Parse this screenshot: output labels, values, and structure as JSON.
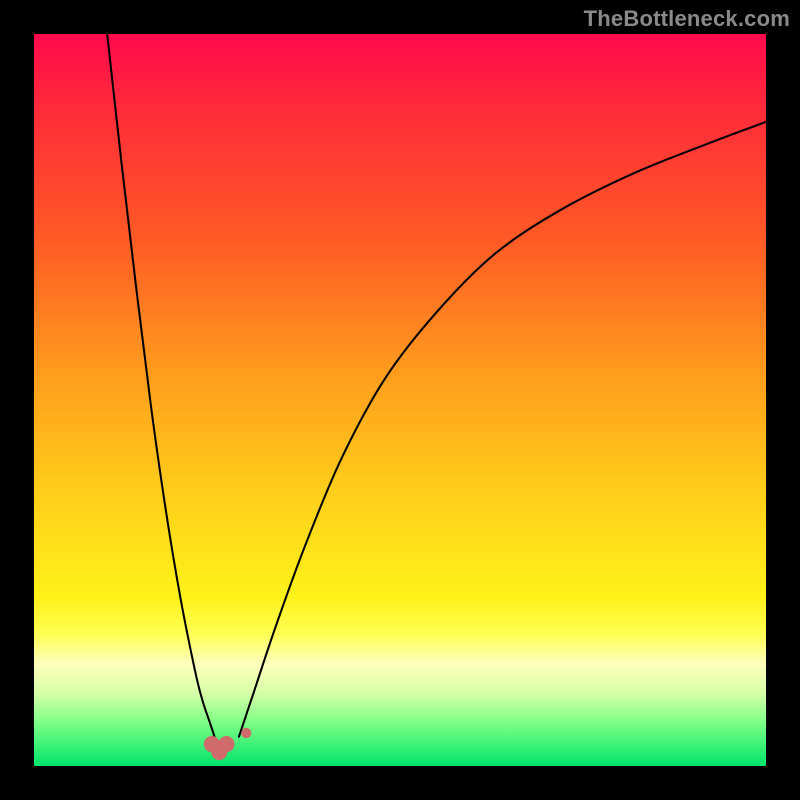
{
  "watermark": "TheBottleneck.com",
  "chart_data": {
    "type": "line",
    "title": "",
    "xlabel": "",
    "ylabel": "",
    "xlim": [
      0,
      100
    ],
    "ylim": [
      0,
      100
    ],
    "grid": false,
    "gradient_stops": [
      {
        "pct": 0.0,
        "color": "#ff0a4d"
      },
      {
        "pct": 0.1,
        "color": "#ff2a3a"
      },
      {
        "pct": 0.28,
        "color": "#ff5a25"
      },
      {
        "pct": 0.48,
        "color": "#ffa21c"
      },
      {
        "pct": 0.64,
        "color": "#ffd21a"
      },
      {
        "pct": 0.77,
        "color": "#fff21a"
      },
      {
        "pct": 0.82,
        "color": "#ffff55"
      },
      {
        "pct": 0.86,
        "color": "#fdffbb"
      },
      {
        "pct": 0.9,
        "color": "#d8ffa8"
      },
      {
        "pct": 0.94,
        "color": "#7fff86"
      },
      {
        "pct": 1.0,
        "color": "#00e46a"
      }
    ],
    "series": [
      {
        "name": "left-arc",
        "x": [
          10,
          12,
          14,
          16,
          18,
          20,
          22,
          23,
          24,
          25
        ],
        "y": [
          100,
          82,
          65,
          49,
          35,
          23,
          13,
          9,
          6,
          3
        ]
      },
      {
        "name": "right-arc",
        "x": [
          28,
          30,
          33,
          37,
          42,
          48,
          55,
          63,
          72,
          82,
          92,
          100
        ],
        "y": [
          4,
          10,
          19,
          30,
          42,
          53,
          62,
          70,
          76,
          81,
          85,
          88
        ]
      }
    ],
    "markers": [
      {
        "name": "u-blob-left",
        "cx": 24.3,
        "cy": 3.0,
        "r": 1.1,
        "color": "#cf6b6b"
      },
      {
        "name": "u-blob-bottom",
        "cx": 25.3,
        "cy": 1.9,
        "r": 1.1,
        "color": "#cf6b6b"
      },
      {
        "name": "u-blob-right",
        "cx": 26.3,
        "cy": 3.0,
        "r": 1.1,
        "color": "#cf6b6b"
      },
      {
        "name": "dot-right",
        "cx": 29.0,
        "cy": 4.5,
        "r": 0.7,
        "color": "#cf6b6b"
      }
    ]
  }
}
